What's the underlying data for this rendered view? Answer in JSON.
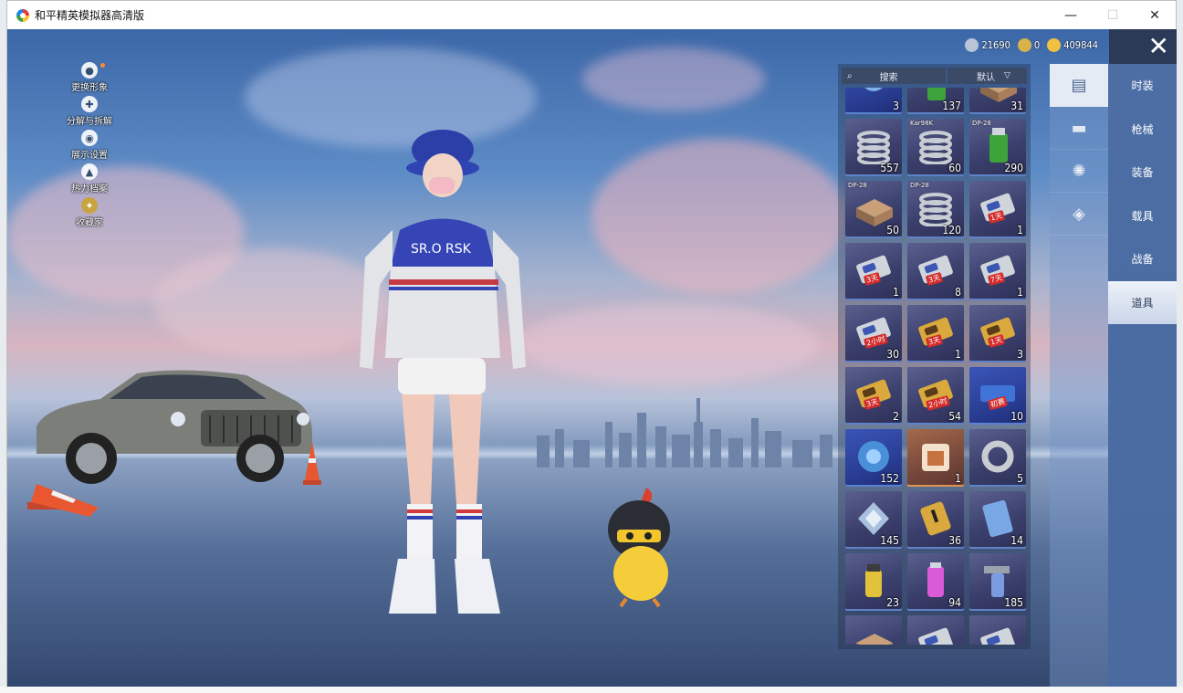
{
  "window": {
    "title": "和平精英模拟器高清版",
    "min": "—",
    "max": "☐",
    "close": "✕"
  },
  "left_menu": [
    {
      "label": "更换形象",
      "icon": "person-icon"
    },
    {
      "label": "分解与拆解",
      "icon": "puzzle-icon"
    },
    {
      "label": "展示设置",
      "icon": "eye-icon"
    },
    {
      "label": "热力档案",
      "icon": "flame-icon"
    },
    {
      "label": "收藏家",
      "icon": "collector-badge-icon"
    }
  ],
  "currency": [
    {
      "name": "silver",
      "value": "21690",
      "color": "#b9c4d6"
    },
    {
      "name": "coupon",
      "value": "0",
      "color": "#d8b24a"
    },
    {
      "name": "gold",
      "value": "409844",
      "color": "#f0c040"
    }
  ],
  "inventory": {
    "search_label": "搜索",
    "sort_label": "默认",
    "items": [
      {
        "qty": "3",
        "tag": "",
        "style": "blue",
        "art": "orb"
      },
      {
        "qty": "137",
        "tag": "",
        "style": "normal",
        "art": "can"
      },
      {
        "qty": "31",
        "tag": "",
        "style": "normal",
        "art": "box"
      },
      {
        "qty": "557",
        "tag": "",
        "style": "normal",
        "art": "spring"
      },
      {
        "qty": "60",
        "tag": "Kar98K",
        "style": "normal",
        "art": "spring"
      },
      {
        "qty": "290",
        "tag": "DP-28",
        "style": "normal",
        "art": "can"
      },
      {
        "qty": "50",
        "tag": "DP-28",
        "style": "normal",
        "art": "box"
      },
      {
        "qty": "120",
        "tag": "DP-28",
        "style": "normal",
        "art": "spring"
      },
      {
        "qty": "1",
        "tag": "",
        "style": "normal",
        "art": "card",
        "badge": "1天"
      },
      {
        "qty": "1",
        "tag": "",
        "style": "normal",
        "art": "card",
        "badge": "3天"
      },
      {
        "qty": "8",
        "tag": "",
        "style": "normal",
        "art": "card",
        "badge": "3天"
      },
      {
        "qty": "1",
        "tag": "",
        "style": "normal",
        "art": "card",
        "badge": "7天"
      },
      {
        "qty": "30",
        "tag": "",
        "style": "normal",
        "art": "card",
        "badge": "2小时"
      },
      {
        "qty": "1",
        "tag": "",
        "style": "normal",
        "art": "goldcard",
        "badge": "3天"
      },
      {
        "qty": "3",
        "tag": "",
        "style": "normal",
        "art": "goldcard",
        "badge": "1天"
      },
      {
        "qty": "2",
        "tag": "",
        "style": "normal",
        "art": "goldcard",
        "badge": "3天"
      },
      {
        "qty": "54",
        "tag": "",
        "style": "normal",
        "art": "goldcard",
        "badge": "2小时"
      },
      {
        "qty": "10",
        "tag": "",
        "style": "blue",
        "art": "ticket",
        "badge": "初赛"
      },
      {
        "qty": "152",
        "tag": "",
        "style": "blue",
        "art": "puzzleorb"
      },
      {
        "qty": "1",
        "tag": "",
        "style": "orange",
        "art": "chest"
      },
      {
        "qty": "5",
        "tag": "",
        "style": "normal",
        "art": "ring"
      },
      {
        "qty": "145",
        "tag": "",
        "style": "normal",
        "art": "diamond"
      },
      {
        "qty": "36",
        "tag": "",
        "style": "normal",
        "art": "goldtag"
      },
      {
        "qty": "14",
        "tag": "",
        "style": "normal",
        "art": "bluecard"
      },
      {
        "qty": "23",
        "tag": "",
        "style": "normal",
        "art": "grenade"
      },
      {
        "qty": "94",
        "tag": "",
        "style": "normal",
        "art": "spray"
      },
      {
        "qty": "185",
        "tag": "",
        "style": "normal",
        "art": "spraygun"
      },
      {
        "qty": "",
        "tag": "",
        "style": "normal",
        "art": "box"
      },
      {
        "qty": "",
        "tag": "",
        "style": "normal",
        "art": "card"
      },
      {
        "qty": "",
        "tag": "",
        "style": "normal",
        "art": "card"
      }
    ]
  },
  "icon_tabs": [
    {
      "icon": "card-icon",
      "glyph": "▤"
    },
    {
      "icon": "briefcase-icon",
      "glyph": "▬"
    },
    {
      "icon": "burst-icon",
      "glyph": "✺"
    },
    {
      "icon": "ticket-icon",
      "glyph": "◈"
    }
  ],
  "categories": [
    {
      "label": "时装"
    },
    {
      "label": "枪械"
    },
    {
      "label": "装备"
    },
    {
      "label": "载具"
    },
    {
      "label": "战备"
    },
    {
      "label": "道具",
      "active": true
    }
  ]
}
